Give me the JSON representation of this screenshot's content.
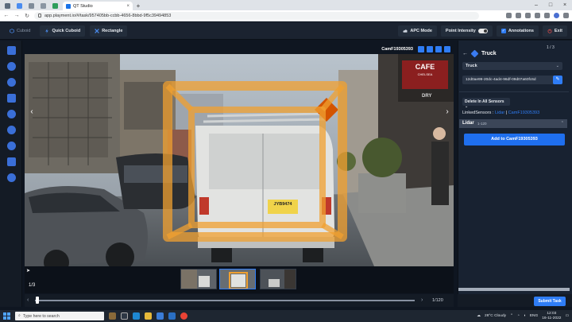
{
  "browser": {
    "tab_title": "QT Studio",
    "url": "app.playment.io/#/task/957405bb-ccbb-4656-8bbd-9f5c39494853"
  },
  "toolbar": {
    "cuboid_label": "Cuboid",
    "quick_cuboid_label": "Quick Cuboid",
    "rectangle_label": "Rectangle",
    "apc_mode_label": "APC Mode",
    "point_intensity_label": "Point Intensity",
    "annotations_label": "Annotations",
    "exit_label": "Exit"
  },
  "viewer": {
    "camera_label": "CamF19305393",
    "frame_counter": "1/3",
    "plate_text": "JYB9474",
    "sign_text": "CAFE",
    "sign_small_text": "CHELSEA",
    "sign_dry": "DRY"
  },
  "timeline": {
    "frame_count": "1/120"
  },
  "panel": {
    "page_indicator": "1 / 3",
    "object_title": "Truck",
    "class_value": "Truck",
    "object_id": "12d0ae99-20dc-4ad4-96df-09d07a60fc6d",
    "delete_label": "Delete In All Sensors",
    "linked_label": "LinkedSensors : ",
    "linked_lidar": "Lidar",
    "linked_cam": "CamF19305393",
    "lidar_title": "Lidar",
    "lidar_sub": "1-120",
    "add_cam_label": "Add to CamF19305393",
    "submit_label": "Submit Task"
  },
  "taskbar": {
    "search_placeholder": "Type here to search",
    "weather": "28°C  Cloudy",
    "lang": "ENG",
    "time": "12:03",
    "date": "16-11-2022"
  },
  "colors": {
    "accent": "#2f7df6",
    "annotation_orange": "#f0a030",
    "app_bg": "#0f1621"
  }
}
